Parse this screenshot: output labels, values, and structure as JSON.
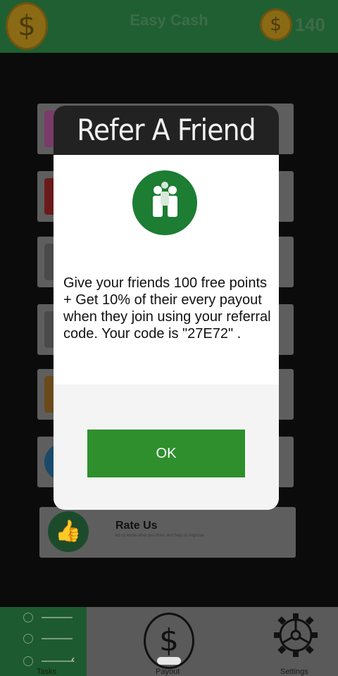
{
  "header": {
    "title": "Easy Cash",
    "logo_icon": "dollar-coin-icon",
    "points_icon": "dollar-coin-icon",
    "points": "140"
  },
  "rate_card": {
    "title": "Rate Us",
    "subtitle": "let us know what you think and help us improve",
    "icon": "thumbs-up-icon"
  },
  "dialog": {
    "title": "Refer A Friend",
    "icon": "friends-icon",
    "message": "Give your friends 100 free points + Get 10% of their every payout when they join using your referral code. Your code is \"27E72\" .",
    "ok_label": "OK"
  },
  "bottom_nav": {
    "tasks_label": "Tasks",
    "payout_label": "Payout",
    "settings_label": "Settings"
  },
  "colors": {
    "brand_green": "#1f5f32",
    "button_green": "#2f8f2d"
  }
}
